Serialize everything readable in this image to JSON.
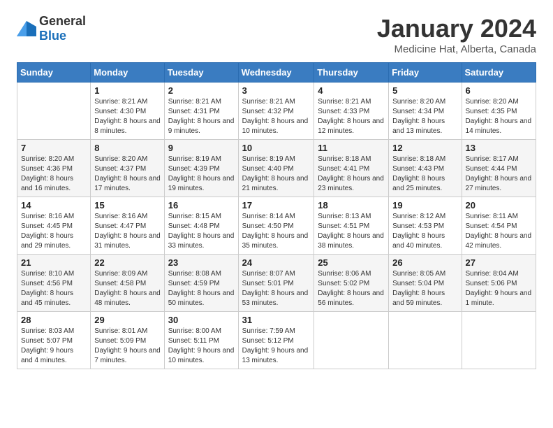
{
  "header": {
    "logo_general": "General",
    "logo_blue": "Blue",
    "month_title": "January 2024",
    "subtitle": "Medicine Hat, Alberta, Canada"
  },
  "weekdays": [
    "Sunday",
    "Monday",
    "Tuesday",
    "Wednesday",
    "Thursday",
    "Friday",
    "Saturday"
  ],
  "weeks": [
    [
      {
        "day": "",
        "sunrise": "",
        "sunset": "",
        "daylight": ""
      },
      {
        "day": "1",
        "sunrise": "Sunrise: 8:21 AM",
        "sunset": "Sunset: 4:30 PM",
        "daylight": "Daylight: 8 hours and 8 minutes."
      },
      {
        "day": "2",
        "sunrise": "Sunrise: 8:21 AM",
        "sunset": "Sunset: 4:31 PM",
        "daylight": "Daylight: 8 hours and 9 minutes."
      },
      {
        "day": "3",
        "sunrise": "Sunrise: 8:21 AM",
        "sunset": "Sunset: 4:32 PM",
        "daylight": "Daylight: 8 hours and 10 minutes."
      },
      {
        "day": "4",
        "sunrise": "Sunrise: 8:21 AM",
        "sunset": "Sunset: 4:33 PM",
        "daylight": "Daylight: 8 hours and 12 minutes."
      },
      {
        "day": "5",
        "sunrise": "Sunrise: 8:20 AM",
        "sunset": "Sunset: 4:34 PM",
        "daylight": "Daylight: 8 hours and 13 minutes."
      },
      {
        "day": "6",
        "sunrise": "Sunrise: 8:20 AM",
        "sunset": "Sunset: 4:35 PM",
        "daylight": "Daylight: 8 hours and 14 minutes."
      }
    ],
    [
      {
        "day": "7",
        "sunrise": "Sunrise: 8:20 AM",
        "sunset": "Sunset: 4:36 PM",
        "daylight": "Daylight: 8 hours and 16 minutes."
      },
      {
        "day": "8",
        "sunrise": "Sunrise: 8:20 AM",
        "sunset": "Sunset: 4:37 PM",
        "daylight": "Daylight: 8 hours and 17 minutes."
      },
      {
        "day": "9",
        "sunrise": "Sunrise: 8:19 AM",
        "sunset": "Sunset: 4:39 PM",
        "daylight": "Daylight: 8 hours and 19 minutes."
      },
      {
        "day": "10",
        "sunrise": "Sunrise: 8:19 AM",
        "sunset": "Sunset: 4:40 PM",
        "daylight": "Daylight: 8 hours and 21 minutes."
      },
      {
        "day": "11",
        "sunrise": "Sunrise: 8:18 AM",
        "sunset": "Sunset: 4:41 PM",
        "daylight": "Daylight: 8 hours and 23 minutes."
      },
      {
        "day": "12",
        "sunrise": "Sunrise: 8:18 AM",
        "sunset": "Sunset: 4:43 PM",
        "daylight": "Daylight: 8 hours and 25 minutes."
      },
      {
        "day": "13",
        "sunrise": "Sunrise: 8:17 AM",
        "sunset": "Sunset: 4:44 PM",
        "daylight": "Daylight: 8 hours and 27 minutes."
      }
    ],
    [
      {
        "day": "14",
        "sunrise": "Sunrise: 8:16 AM",
        "sunset": "Sunset: 4:45 PM",
        "daylight": "Daylight: 8 hours and 29 minutes."
      },
      {
        "day": "15",
        "sunrise": "Sunrise: 8:16 AM",
        "sunset": "Sunset: 4:47 PM",
        "daylight": "Daylight: 8 hours and 31 minutes."
      },
      {
        "day": "16",
        "sunrise": "Sunrise: 8:15 AM",
        "sunset": "Sunset: 4:48 PM",
        "daylight": "Daylight: 8 hours and 33 minutes."
      },
      {
        "day": "17",
        "sunrise": "Sunrise: 8:14 AM",
        "sunset": "Sunset: 4:50 PM",
        "daylight": "Daylight: 8 hours and 35 minutes."
      },
      {
        "day": "18",
        "sunrise": "Sunrise: 8:13 AM",
        "sunset": "Sunset: 4:51 PM",
        "daylight": "Daylight: 8 hours and 38 minutes."
      },
      {
        "day": "19",
        "sunrise": "Sunrise: 8:12 AM",
        "sunset": "Sunset: 4:53 PM",
        "daylight": "Daylight: 8 hours and 40 minutes."
      },
      {
        "day": "20",
        "sunrise": "Sunrise: 8:11 AM",
        "sunset": "Sunset: 4:54 PM",
        "daylight": "Daylight: 8 hours and 42 minutes."
      }
    ],
    [
      {
        "day": "21",
        "sunrise": "Sunrise: 8:10 AM",
        "sunset": "Sunset: 4:56 PM",
        "daylight": "Daylight: 8 hours and 45 minutes."
      },
      {
        "day": "22",
        "sunrise": "Sunrise: 8:09 AM",
        "sunset": "Sunset: 4:58 PM",
        "daylight": "Daylight: 8 hours and 48 minutes."
      },
      {
        "day": "23",
        "sunrise": "Sunrise: 8:08 AM",
        "sunset": "Sunset: 4:59 PM",
        "daylight": "Daylight: 8 hours and 50 minutes."
      },
      {
        "day": "24",
        "sunrise": "Sunrise: 8:07 AM",
        "sunset": "Sunset: 5:01 PM",
        "daylight": "Daylight: 8 hours and 53 minutes."
      },
      {
        "day": "25",
        "sunrise": "Sunrise: 8:06 AM",
        "sunset": "Sunset: 5:02 PM",
        "daylight": "Daylight: 8 hours and 56 minutes."
      },
      {
        "day": "26",
        "sunrise": "Sunrise: 8:05 AM",
        "sunset": "Sunset: 5:04 PM",
        "daylight": "Daylight: 8 hours and 59 minutes."
      },
      {
        "day": "27",
        "sunrise": "Sunrise: 8:04 AM",
        "sunset": "Sunset: 5:06 PM",
        "daylight": "Daylight: 9 hours and 1 minute."
      }
    ],
    [
      {
        "day": "28",
        "sunrise": "Sunrise: 8:03 AM",
        "sunset": "Sunset: 5:07 PM",
        "daylight": "Daylight: 9 hours and 4 minutes."
      },
      {
        "day": "29",
        "sunrise": "Sunrise: 8:01 AM",
        "sunset": "Sunset: 5:09 PM",
        "daylight": "Daylight: 9 hours and 7 minutes."
      },
      {
        "day": "30",
        "sunrise": "Sunrise: 8:00 AM",
        "sunset": "Sunset: 5:11 PM",
        "daylight": "Daylight: 9 hours and 10 minutes."
      },
      {
        "day": "31",
        "sunrise": "Sunrise: 7:59 AM",
        "sunset": "Sunset: 5:12 PM",
        "daylight": "Daylight: 9 hours and 13 minutes."
      },
      {
        "day": "",
        "sunrise": "",
        "sunset": "",
        "daylight": ""
      },
      {
        "day": "",
        "sunrise": "",
        "sunset": "",
        "daylight": ""
      },
      {
        "day": "",
        "sunrise": "",
        "sunset": "",
        "daylight": ""
      }
    ]
  ]
}
